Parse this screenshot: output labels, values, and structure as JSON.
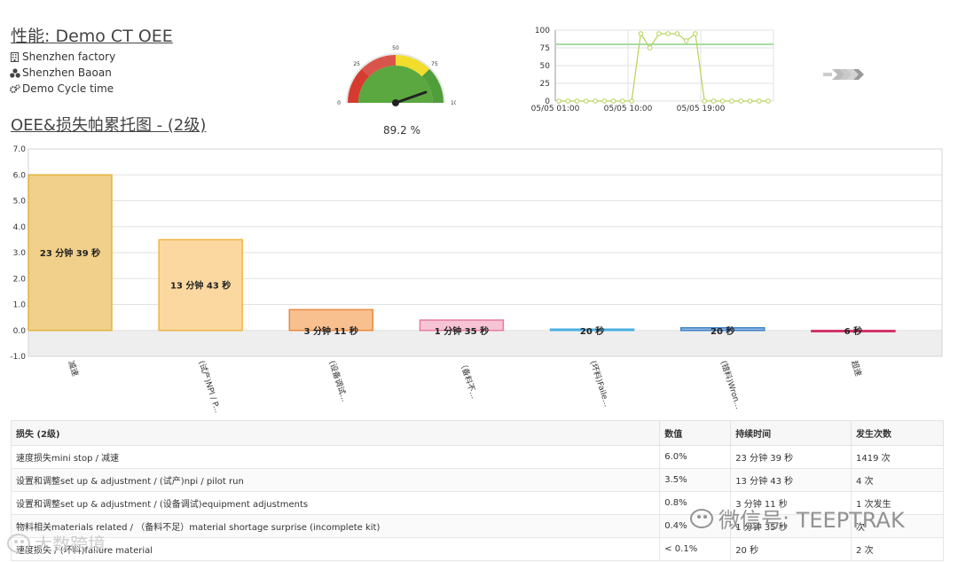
{
  "header": {
    "title": "性能: Demo CT OEE",
    "factory": "Shenzhen factory",
    "site": "Shenzhen Baoan",
    "cycle": "Demo Cycle time"
  },
  "icons": {
    "factory": "building-icon",
    "site": "sitemap-icon",
    "cycle": "gears-icon",
    "next": "arrow-right-icon"
  },
  "gauge": {
    "value": 89.2,
    "value_label": "89.2 %",
    "ticks": [
      "0",
      "25",
      "50",
      "75",
      "100"
    ],
    "colors": {
      "red": "#d63b2f",
      "yellow": "#f2dd2c",
      "green": "#4f9e3a",
      "face": "#e9e9e9"
    }
  },
  "trend_chart": {
    "type": "line",
    "x_labels": [
      "05/05 01:00",
      "05/05 10:00",
      "05/05 19:00"
    ],
    "y_ticks": [
      "100",
      "75",
      "50",
      "25",
      "0"
    ],
    "ylim": [
      0,
      100
    ],
    "target": 80,
    "values": [
      0,
      0,
      0,
      0,
      0,
      0,
      0,
      0,
      0,
      95,
      75,
      95,
      95,
      95,
      85,
      95,
      0,
      0,
      0,
      0,
      0,
      0,
      0,
      0
    ],
    "colors": {
      "line": "#b7d25a",
      "target": "#a9dca5"
    }
  },
  "pareto": {
    "title": "OEE&损失帕累托图 - (2级)"
  },
  "chart_data": {
    "type": "bar",
    "categories": [
      "减速",
      "(试产)NPI / P...",
      "(设备调试...",
      "（备料不...",
      "(坏料)Faile...",
      "(错料)Wron...",
      "超速"
    ],
    "values": [
      6.0,
      3.5,
      0.8,
      0.4,
      0.05,
      0.1,
      -0.05
    ],
    "bar_labels": [
      "23 分钟 39 秒",
      "13 分钟 43 秒",
      "3 分钟 11 秒",
      "1 分钟 35 秒",
      "20 秒",
      "20 秒",
      "6 秒"
    ],
    "y_ticks": [
      "7.0",
      "6.0",
      "5.0",
      "4.0",
      "3.0",
      "2.0",
      "1.0",
      "0.0",
      "-1.0"
    ],
    "ylim": [
      -1,
      7
    ],
    "fills": [
      "#f0d08a",
      "#fbd8a0",
      "#f7c08e",
      "#f6c4d4",
      "#a9d9ef",
      "#9ec0e4",
      "#e7a7bb"
    ],
    "strokes": [
      "#e3b341",
      "#f0b443",
      "#e9893f",
      "#e87ba0",
      "#4ab0e0",
      "#3a7fc8",
      "#d6336a"
    ]
  },
  "table": {
    "headers": [
      "损失 (2级)",
      "数值",
      "持续时间",
      "发生次数"
    ],
    "rows": [
      [
        "速度损失mini stop / 减速",
        "6.0%",
        "23 分钟 39 秒",
        "1419 次"
      ],
      [
        "设置和调整set up & adjustment / (试产)npi / pilot run",
        "3.5%",
        "13 分钟 43 秒",
        "4 次"
      ],
      [
        "设置和调整set up & adjustment / (设备调试)equipment adjustments",
        "0.8%",
        "3 分钟 11 秒",
        "1 次发生"
      ],
      [
        "物料相关materials related / （备料不足）material shortage surprise (incomplete kit)",
        "0.4%",
        "1 分钟 35 秒",
        "次"
      ],
      [
        "速度损失 / (坏料)failure material",
        "< 0.1%",
        "20 秒",
        "2 次"
      ]
    ]
  },
  "watermarks": {
    "right": "微信号: TEEPTRAK",
    "left": "大数跨境"
  }
}
